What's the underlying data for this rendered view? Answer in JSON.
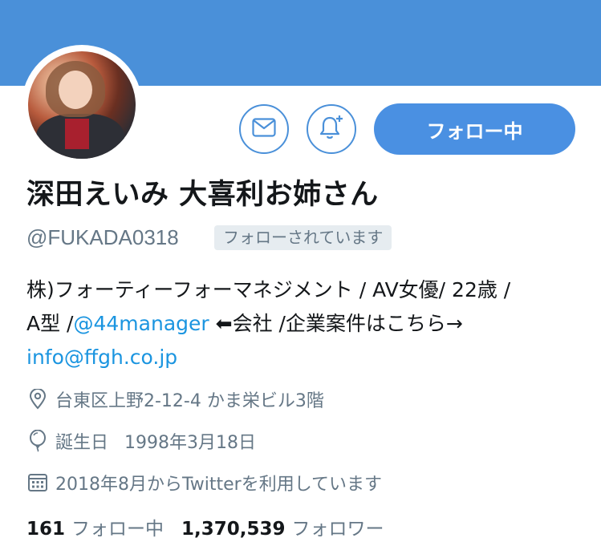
{
  "profile": {
    "display_name": "深田えいみ 大喜利お姉さん",
    "handle": "@FUKADA0318",
    "follows_you_label": "フォローされています",
    "follow_button_label": "フォロー中"
  },
  "bio": {
    "line1": "株)フォーティーフォーマネジメント / AV女優/ 22歳 /",
    "line2_prefix": "A型 /",
    "mention": "@44manager",
    "line2_suffix": " ⬅会社 /企業案件はこちら→",
    "email": "info@ffgh.co.jp"
  },
  "meta": {
    "location": "台東区上野2-12-4 かま栄ビル3階",
    "birthday_label": "誕生日",
    "birthday_value": "1998年3月18日",
    "joined": "2018年8月からTwitterを利用しています"
  },
  "stats": {
    "following_count": "161",
    "following_label": "フォロー中",
    "followers_count": "1,370,539",
    "followers_label": "フォロワー"
  },
  "icons": {
    "mail": "mail-icon",
    "bell": "bell-plus-icon",
    "location": "location-pin-icon",
    "birthday": "balloon-icon",
    "calendar": "calendar-icon"
  },
  "colors": {
    "banner": "#4a90d9",
    "accent": "#1b95e0",
    "follow_button": "#4a90e2",
    "secondary_text": "#657786"
  }
}
